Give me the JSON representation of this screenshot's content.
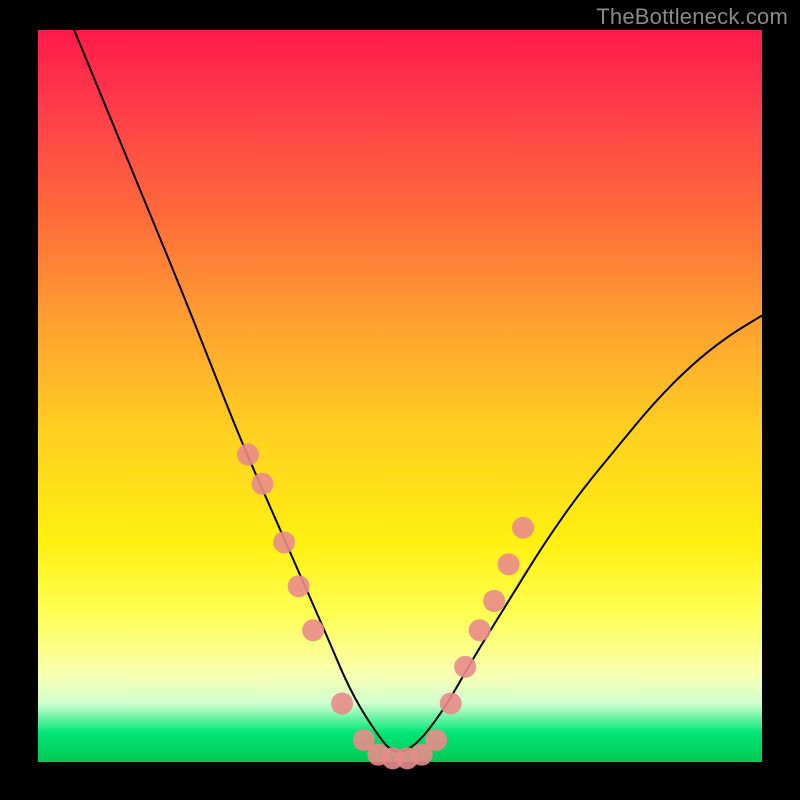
{
  "watermark": "TheBottleneck.com",
  "chart_data": {
    "type": "line",
    "title": "",
    "xlabel": "",
    "ylabel": "",
    "xlim": [
      0,
      100
    ],
    "ylim": [
      0,
      100
    ],
    "series": [
      {
        "name": "bottleneck-curve",
        "x": [
          5,
          10,
          15,
          20,
          24,
          28,
          32,
          36,
          40,
          43,
          46,
          49,
          52,
          56,
          60,
          65,
          70,
          75,
          80,
          85,
          90,
          95,
          100
        ],
        "values": [
          100,
          88,
          76,
          64,
          54,
          44,
          35,
          26,
          17,
          10,
          5,
          1,
          2,
          7,
          14,
          22,
          30,
          37,
          43,
          49,
          54,
          58,
          61
        ]
      }
    ],
    "markers": {
      "name": "highlight-points",
      "x": [
        29,
        31,
        34,
        36,
        38,
        42,
        45,
        47,
        49,
        51,
        53,
        55,
        57,
        59,
        61,
        63,
        65,
        67
      ],
      "values": [
        42,
        38,
        30,
        24,
        18,
        8,
        3,
        1,
        0.5,
        0.5,
        1,
        3,
        8,
        13,
        18,
        22,
        27,
        32
      ]
    }
  }
}
